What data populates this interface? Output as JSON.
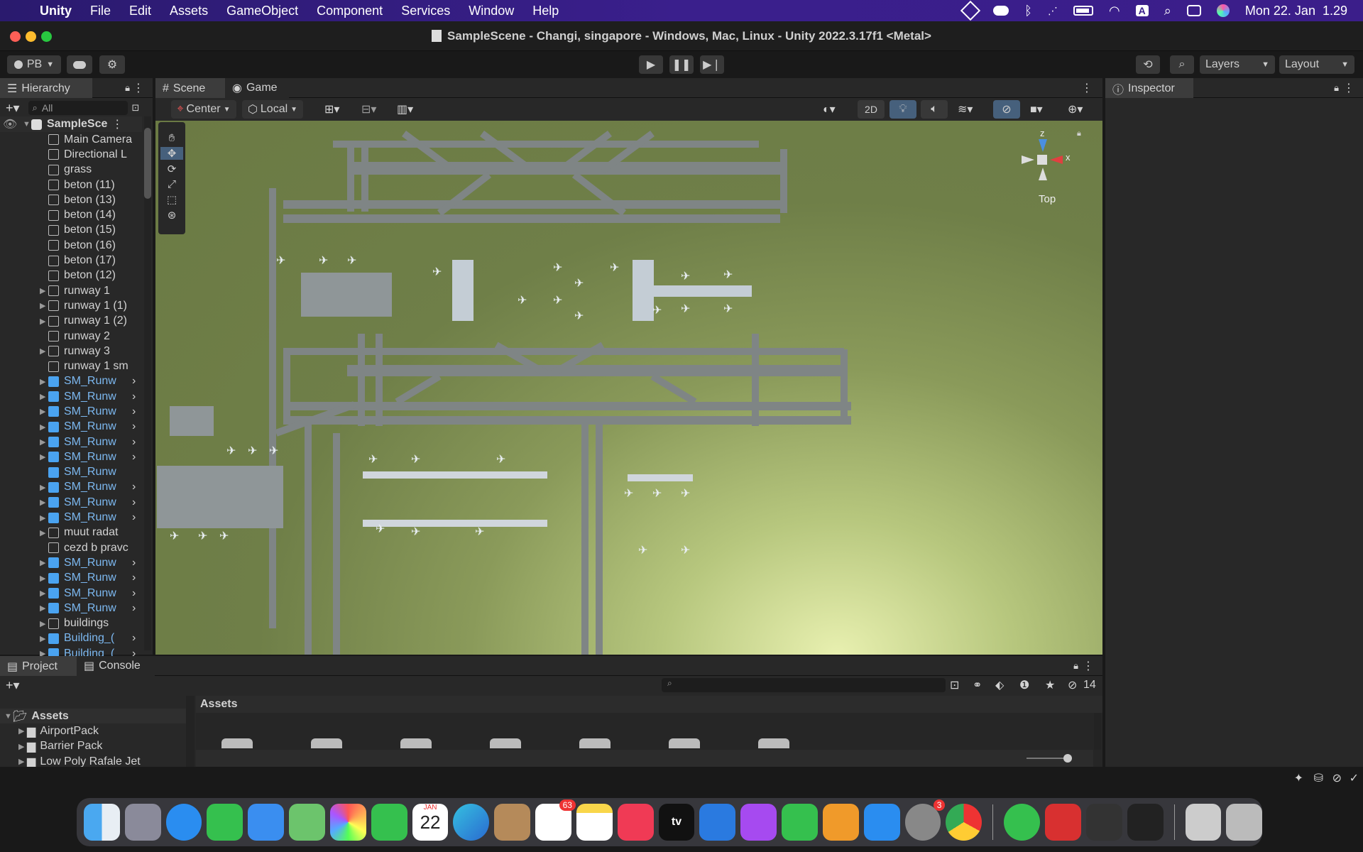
{
  "menubar": {
    "apple": "",
    "app": "Unity",
    "items": [
      "File",
      "Edit",
      "Assets",
      "GameObject",
      "Component",
      "Services",
      "Window",
      "Help"
    ],
    "clock": "Mon 22. Jan  1.29",
    "input_source": "A"
  },
  "titlebar": {
    "title": "SampleScene - Changi, singapore - Windows, Mac, Linux - Unity 2022.3.17f1 <Metal>"
  },
  "toolbar": {
    "account": "PB",
    "layers": "Layers",
    "layout": "Layout"
  },
  "hierarchy": {
    "tab": "Hierarchy",
    "search_placeholder": "All",
    "scene": "SampleSce",
    "rows": [
      {
        "label": "Main Camera",
        "expand": false,
        "blue": false
      },
      {
        "label": "Directional L",
        "expand": false,
        "blue": false
      },
      {
        "label": "grass",
        "expand": false,
        "blue": false
      },
      {
        "label": "beton (11)",
        "expand": false,
        "blue": false
      },
      {
        "label": "beton (13)",
        "expand": false,
        "blue": false
      },
      {
        "label": "beton (14)",
        "expand": false,
        "blue": false
      },
      {
        "label": "beton (15)",
        "expand": false,
        "blue": false
      },
      {
        "label": "beton (16)",
        "expand": false,
        "blue": false
      },
      {
        "label": "beton (17)",
        "expand": false,
        "blue": false
      },
      {
        "label": "beton (12)",
        "expand": false,
        "blue": false
      },
      {
        "label": "runway 1",
        "expand": true,
        "blue": false
      },
      {
        "label": "runway 1 (1)",
        "expand": true,
        "blue": false
      },
      {
        "label": "runway 1 (2)",
        "expand": true,
        "blue": false
      },
      {
        "label": "runway 2",
        "expand": false,
        "blue": false
      },
      {
        "label": "runway 3",
        "expand": true,
        "blue": false
      },
      {
        "label": "runway 1 sm",
        "expand": false,
        "blue": false
      },
      {
        "label": "SM_Runw",
        "expand": true,
        "blue": true
      },
      {
        "label": "SM_Runw",
        "expand": true,
        "blue": true
      },
      {
        "label": "SM_Runw",
        "expand": true,
        "blue": true
      },
      {
        "label": "SM_Runw",
        "expand": true,
        "blue": true
      },
      {
        "label": "SM_Runw",
        "expand": true,
        "blue": true
      },
      {
        "label": "SM_Runw",
        "expand": true,
        "blue": true
      },
      {
        "label": "SM_Runw",
        "expand": false,
        "blue": true
      },
      {
        "label": "SM_Runw",
        "expand": true,
        "blue": true
      },
      {
        "label": "SM_Runw",
        "expand": true,
        "blue": true
      },
      {
        "label": "SM_Runw",
        "expand": true,
        "blue": true
      },
      {
        "label": "muut radat",
        "expand": true,
        "blue": false
      },
      {
        "label": "cezd b pravc",
        "expand": false,
        "blue": false
      },
      {
        "label": "SM_Runw",
        "expand": true,
        "blue": true
      },
      {
        "label": "SM_Runw",
        "expand": true,
        "blue": true
      },
      {
        "label": "SM_Runw",
        "expand": true,
        "blue": true
      },
      {
        "label": "SM_Runw",
        "expand": true,
        "blue": true
      },
      {
        "label": "buildings",
        "expand": true,
        "blue": false
      },
      {
        "label": "Building_(",
        "expand": true,
        "blue": true
      },
      {
        "label": "Building_(",
        "expand": true,
        "blue": true
      }
    ]
  },
  "scene": {
    "tabs": [
      "Scene",
      "Game"
    ],
    "pivot": "Center",
    "space": "Local",
    "mode_2d": "2D",
    "gizmo_view": "Top",
    "gizmo_x": "x",
    "gizmo_z": "z"
  },
  "inspector": {
    "tab": "Inspector"
  },
  "project": {
    "tabs": [
      "Project",
      "Console"
    ],
    "tree": [
      "Assets",
      "AirportPack",
      "Barrier Pack",
      "Low Poly Rafale Jet"
    ],
    "breadcrumb": "Assets",
    "hidden_count": "14"
  },
  "dock": {
    "calendar_month": "JAN",
    "calendar_day": "22",
    "reminders_badge": "63",
    "settings_badge": "3",
    "appletv": "tv"
  }
}
